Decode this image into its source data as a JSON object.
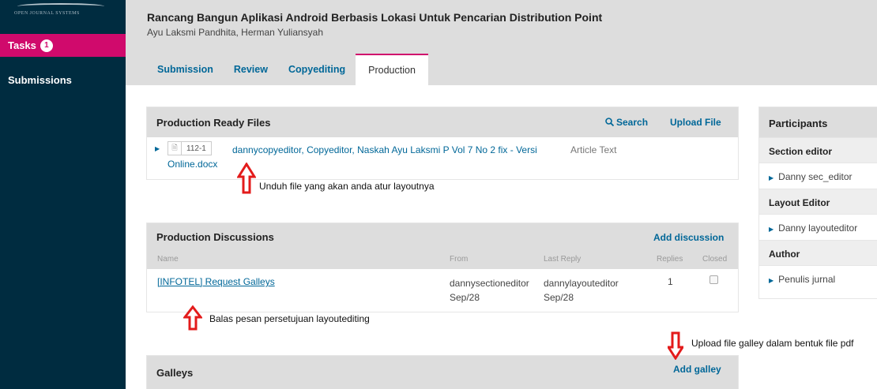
{
  "sidebar": {
    "logo_text": "OPEN JOURNAL SYSTEMS",
    "tasks_label": "Tasks",
    "tasks_count": "1",
    "submissions_label": "Submissions"
  },
  "header": {
    "title": "Rancang Bangun Aplikasi Android Berbasis Lokasi Untuk Pencarian Distribution Point",
    "authors": "Ayu Laksmi Pandhita, Herman Yuliansyah",
    "tabs": [
      {
        "label": "Submission"
      },
      {
        "label": "Review"
      },
      {
        "label": "Copyediting"
      },
      {
        "label": "Production"
      }
    ]
  },
  "production_ready": {
    "title": "Production Ready Files",
    "search_label": "Search",
    "upload_label": "Upload File",
    "file": {
      "id": "112-1",
      "name": "dannycopyeditor, Copyeditor, Naskah Ayu Laksmi P Vol 7 No 2 fix - Versi Online.docx",
      "type": "Article Text"
    }
  },
  "discussions": {
    "title": "Production Discussions",
    "add_label": "Add discussion",
    "columns": {
      "name": "Name",
      "from": "From",
      "last_reply": "Last Reply",
      "replies": "Replies",
      "closed": "Closed"
    },
    "rows": [
      {
        "name": "[INFOTEL] Request Galleys",
        "from_user": "dannysectioneditor",
        "from_date": "Sep/28",
        "last_user": "dannylayouteditor",
        "last_date": "Sep/28",
        "replies": "1"
      }
    ]
  },
  "galleys": {
    "title": "Galleys",
    "add_label": "Add galley"
  },
  "participants": {
    "title": "Participants",
    "groups": [
      {
        "role": "Section editor",
        "person": "Danny sec_editor"
      },
      {
        "role": "Layout Editor",
        "person": "Danny layouteditor"
      },
      {
        "role": "Author",
        "person": "Penulis jurnal"
      }
    ]
  },
  "annotations": {
    "note1": "Unduh file yang akan anda atur layoutnya",
    "note2": "Balas pesan persetujuan layoutediting",
    "note3": "Upload file galley dalam bentuk file pdf"
  },
  "colors": {
    "accent": "#d00a6c",
    "sidebar": "#002c40",
    "link": "#006798",
    "annotation": "#e31b1b"
  }
}
